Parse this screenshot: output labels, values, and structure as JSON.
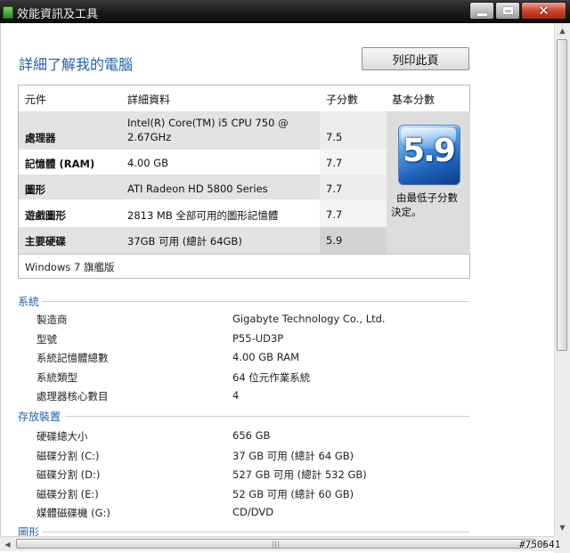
{
  "window": {
    "title": "效能資訊及工具"
  },
  "page": {
    "title": "詳細了解我的電腦",
    "print_label": "列印此頁"
  },
  "scores": {
    "headers": {
      "component": "元件",
      "details": "詳細資料",
      "subscore": "子分數",
      "base": "基本分數"
    },
    "rows": [
      {
        "component": "處理器",
        "details_line1": "Intel(R) Core(TM) i5 CPU 750 @",
        "details_line2": "2.67GHz",
        "subscore": "7.5"
      },
      {
        "component": "記憶體 (RAM)",
        "details": "4.00 GB",
        "subscore": "7.7"
      },
      {
        "component": "圖形",
        "details": "ATI Radeon HD 5800 Series",
        "subscore": "7.7"
      },
      {
        "component": "遊戲圖形",
        "details": "2813 MB 全部可用的圖形記憶體",
        "subscore": "7.7"
      },
      {
        "component": "主要硬碟",
        "details": "37GB 可用 (總計 64GB)",
        "subscore": "5.9"
      }
    ],
    "base_score": "5.9",
    "base_desc_line1": "由最低子分數",
    "base_desc_line2": "決定。",
    "os": "Windows 7 旗艦版"
  },
  "system": {
    "title": "系統",
    "items": [
      {
        "label": "製造商",
        "value": "Gigabyte Technology Co., Ltd."
      },
      {
        "label": "型號",
        "value": "P55-UD3P"
      },
      {
        "label": "系統記憶體總數",
        "value": "4.00 GB RAM"
      },
      {
        "label": "系統類型",
        "value": "64 位元作業系統"
      },
      {
        "label": "處理器核心數目",
        "value": "4"
      }
    ]
  },
  "storage": {
    "title": "存放裝置",
    "items": [
      {
        "label": "硬碟總大小",
        "value": "656 GB"
      },
      {
        "label": "磁碟分割 (C:)",
        "value": "37 GB 可用 (總計 64 GB)"
      },
      {
        "label": "磁碟分割 (D:)",
        "value": "527 GB 可用 (總計 532 GB)"
      },
      {
        "label": "磁碟分割 (E:)",
        "value": "52 GB 可用 (總計 60 GB)"
      },
      {
        "label": "媒體磁碟機 (G:)",
        "value": "CD/DVD"
      }
    ]
  },
  "graphics": {
    "title": "圖形"
  },
  "watermark": "#750541",
  "colors": {
    "heading_blue": "#1f5fa6",
    "close_red": "#c9452e",
    "row_gray": "#e3e3e3"
  }
}
